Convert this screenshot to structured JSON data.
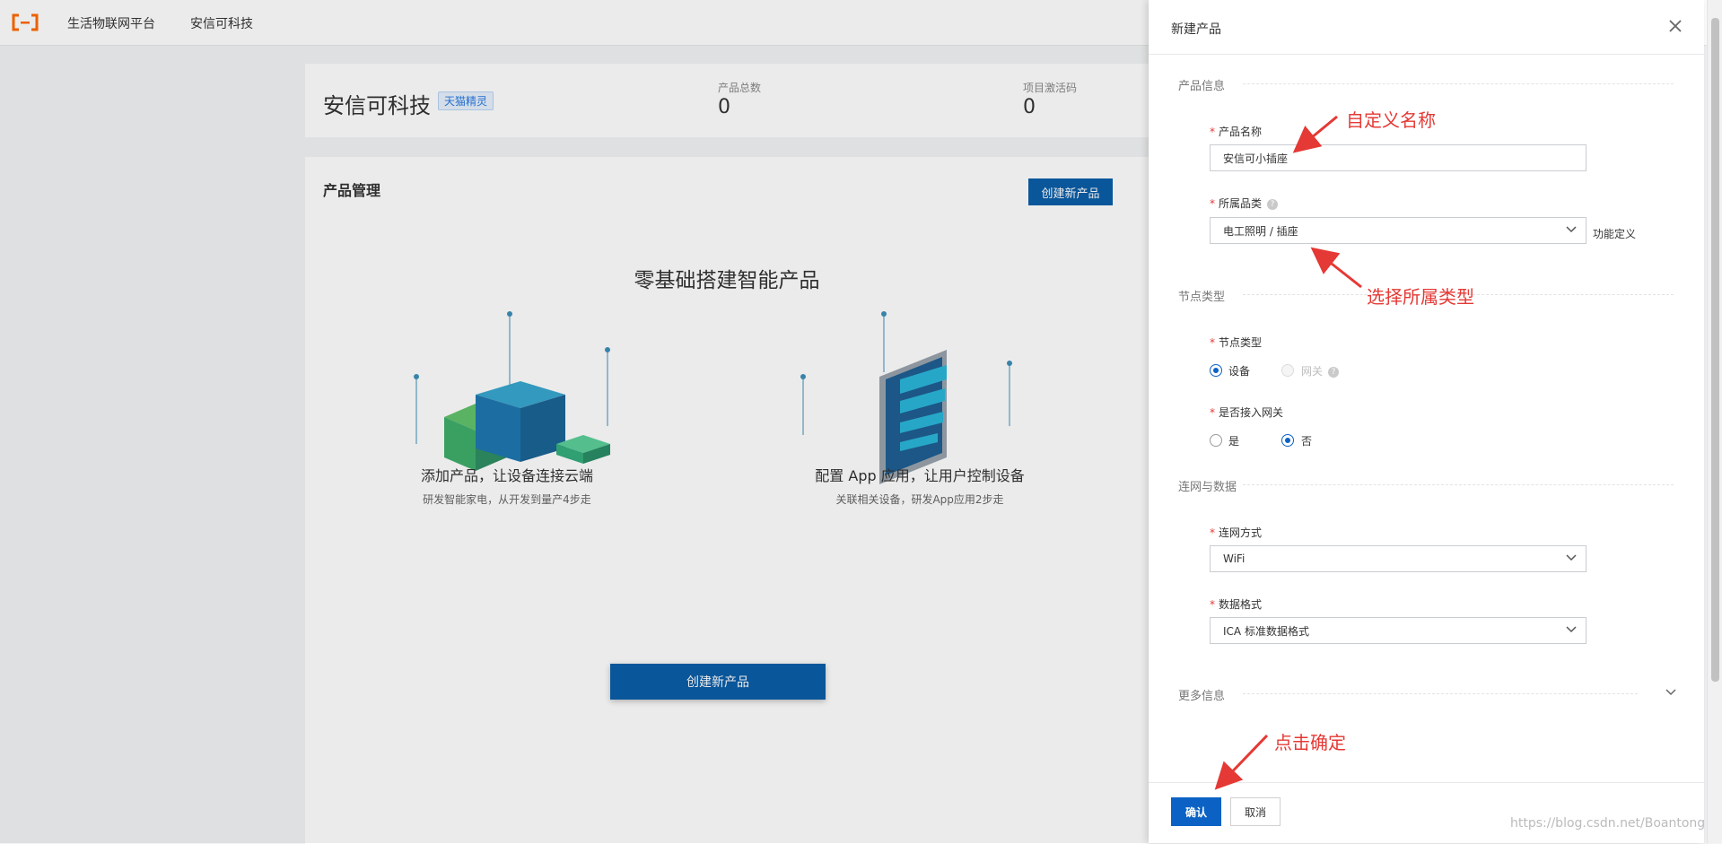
{
  "topbar": {
    "nav_items": [
      "生活物联网平台",
      "安信可科技"
    ]
  },
  "summary": {
    "org_name": "安信可科技",
    "org_tag": "天猫精灵",
    "stats": [
      {
        "label": "产品总数",
        "value": "0"
      },
      {
        "label": "项目激活码",
        "value": "0"
      }
    ]
  },
  "product_management": {
    "title": "产品管理",
    "create_button": "创建新产品",
    "hero_title": "零基础搭建智能产品",
    "features": [
      {
        "title": "添加产品，让设备连接云端",
        "subtitle": "研发智能家电，从开发到量产4步走"
      },
      {
        "title": "配置 App 应用，让用户控制设备",
        "subtitle": "关联相关设备，研发App应用2步走"
      }
    ],
    "main_button": "创建新产品"
  },
  "drawer": {
    "title": "新建产品",
    "sections": {
      "product_info": "产品信息",
      "node_type": "节点类型",
      "network_data": "连网与数据",
      "more_info": "更多信息"
    },
    "fields": {
      "product_name_label": "产品名称",
      "product_name_value": "安信可小插座",
      "category_label": "所属品类",
      "category_value": "电工照明 / 插座",
      "function_definition": "功能定义",
      "node_type_label": "节点类型",
      "node_type_options": [
        "设备",
        "网关"
      ],
      "gateway_label": "是否接入网关",
      "gateway_options": [
        "是",
        "否"
      ],
      "network_label": "连网方式",
      "network_value": "WiFi",
      "data_format_label": "数据格式",
      "data_format_value": "ICA 标准数据格式"
    },
    "footer": {
      "confirm": "确认",
      "cancel": "取消"
    }
  },
  "annotations": {
    "custom_name": "自定义名称",
    "select_category": "选择所属类型",
    "click_confirm": "点击确定"
  },
  "watermark": "https://blog.csdn.net/Boantong",
  "colors": {
    "primary": "#0b62c4",
    "annotation": "#e53935",
    "logo": "#ff6a00"
  }
}
